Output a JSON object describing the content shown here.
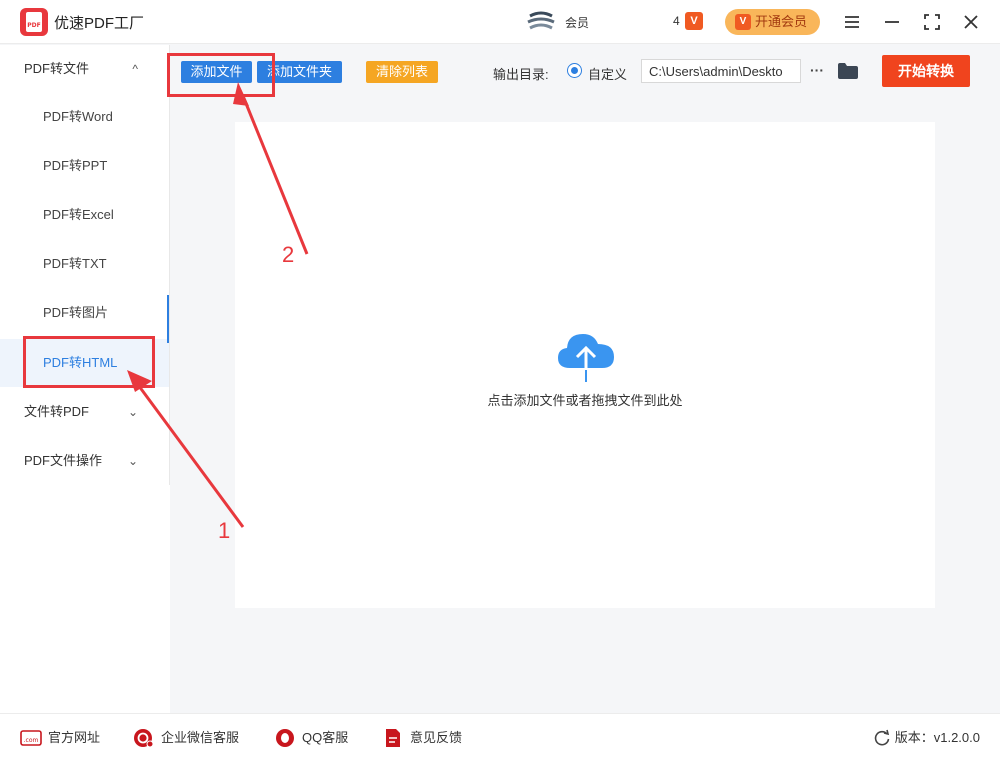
{
  "titlebar": {
    "app_title": "优速PDF工厂",
    "logo_text": "PDF",
    "user_name": "会员",
    "vip_count": "4",
    "vip_mark": "V",
    "vip_button": "开通会员"
  },
  "sidebar": {
    "groups": [
      {
        "label": "PDF转文件",
        "chevron": "up"
      },
      {
        "label": "文件转PDF",
        "chevron": "down"
      },
      {
        "label": "PDF文件操作",
        "chevron": "down"
      }
    ],
    "items": [
      {
        "label": "PDF转Word"
      },
      {
        "label": "PDF转PPT"
      },
      {
        "label": "PDF转Excel"
      },
      {
        "label": "PDF转TXT"
      },
      {
        "label": "PDF转图片"
      },
      {
        "label": "PDF转HTML",
        "active": true
      }
    ]
  },
  "toolbar": {
    "add_file": "添加文件",
    "add_folder": "添加文件夹",
    "clear_list": "清除列表",
    "output_label": "输出目录:",
    "radio_label": "自定义",
    "output_path": "C:\\Users\\admin\\Deskto",
    "more": "···",
    "start": "开始转换"
  },
  "drop_area": {
    "hint": "点击添加文件或者拖拽文件到此处"
  },
  "footer": {
    "website": "官方网址",
    "wechat": "企业微信客服",
    "qq": "QQ客服",
    "feedback": "意见反馈",
    "version": "版本：v1.2.0.0"
  },
  "annotations": {
    "label_1": "1",
    "label_2": "2"
  },
  "colors": {
    "accent_blue": "#2d7fe0",
    "start_red": "#f0441e",
    "clear_orange": "#f5a623",
    "annotation_red": "#e8383d",
    "vip_gold": "#f9b65a"
  }
}
